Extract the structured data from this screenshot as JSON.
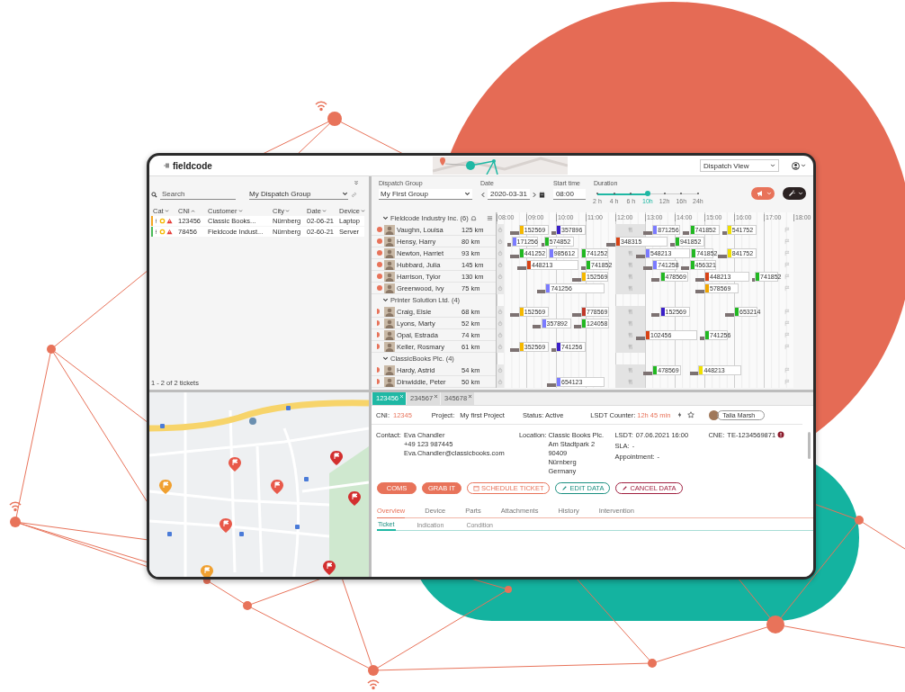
{
  "app": {
    "logo": "fieldcode",
    "view_select": "Dispatch View"
  },
  "tickets_panel": {
    "search": {
      "placeholder": "Search"
    },
    "group_select": "My Dispatch Group",
    "columns": [
      {
        "label": "Cat",
        "sorted": false
      },
      {
        "label": "CNI",
        "sorted": true
      },
      {
        "label": "Customer",
        "sorted": false
      },
      {
        "label": "City",
        "sorted": false
      },
      {
        "label": "Date",
        "sorted": false
      },
      {
        "label": "Device",
        "sorted": false
      }
    ],
    "rows": [
      {
        "color": "#f5a623",
        "cells": [
          "",
          "123456",
          "Classic Books...",
          "Nürnberg",
          "02-06-21",
          "Laptop"
        ]
      },
      {
        "color": "#4cbb5a",
        "cells": [
          "",
          "78456",
          "Fieldcode Indust...",
          "Nürnberg",
          "02-60-21",
          "Server"
        ]
      }
    ],
    "footer": "1 - 2 of 2 tickets"
  },
  "dispatch": {
    "group_label": "Dispatch Group",
    "group_select": "My First Group",
    "date_label": "Date",
    "date": "2020-03-31",
    "start_label": "Start time",
    "start_time": "08:00",
    "duration_label": "Duration",
    "duration_slider": {
      "level": 0.5
    },
    "durations": [
      {
        "label": "2 h",
        "selected": false
      },
      {
        "label": "4 h",
        "selected": false
      },
      {
        "label": "6 h",
        "selected": false
      },
      {
        "label": "10h",
        "selected": true
      },
      {
        "label": "12h",
        "selected": false
      },
      {
        "label": "16h",
        "selected": false
      },
      {
        "label": "24h",
        "selected": false
      }
    ],
    "hours": [
      "08:00",
      "09:00",
      "10:00",
      "11:00",
      "12:00",
      "13:00",
      "14:00",
      "15:00",
      "16:00",
      "17:00",
      "18:00"
    ],
    "groups": [
      {
        "name": "Fieldcode Industry Inc. (6)",
        "expanded": true,
        "technicians": [
          {
            "name": "Vaughn, Louisa",
            "distance": "125 km",
            "kind": "dot",
            "tickets": [
              {
                "id": "152569",
                "color": "#f5b800"
              },
              {
                "id": "357896",
                "color": "#3a1fc8"
              },
              {
                "id": "871256",
                "color": "#7b7bff"
              },
              {
                "id": "741852",
                "color": "#22b822"
              },
              {
                "id": "541752",
                "color": "#f0e000"
              }
            ]
          },
          {
            "name": "Hensy, Harry",
            "distance": "80 km",
            "kind": "dot",
            "tickets": [
              {
                "id": "171256",
                "color": "#7b7bff"
              },
              {
                "id": "574852",
                "color": "#22b822"
              },
              {
                "id": "348315",
                "color": "#d84315"
              },
              {
                "id": "941852",
                "color": "#22b822"
              }
            ]
          },
          {
            "name": "Newton, Harriet",
            "distance": "93 km",
            "kind": "dot",
            "tickets": [
              {
                "id": "441252",
                "color": "#22b822"
              },
              {
                "id": "985612",
                "color": "#7b7bff"
              },
              {
                "id": "741252",
                "color": "#22b822"
              },
              {
                "id": "548213",
                "color": "#7b7bff"
              },
              {
                "id": "741852",
                "color": "#22b822"
              },
              {
                "id": "841752",
                "color": "#f0e000"
              }
            ]
          },
          {
            "name": "Hubbard, Julia",
            "distance": "145 km",
            "kind": "dot",
            "tickets": [
              {
                "id": "448213",
                "color": "#d84315"
              },
              {
                "id": "741852",
                "color": "#22b822"
              },
              {
                "id": "741258",
                "color": "#7b7bff"
              },
              {
                "id": "456321",
                "color": "#22b822"
              }
            ]
          },
          {
            "name": "Harrison, Tylor",
            "distance": "130 km",
            "kind": "dot",
            "tickets": [
              {
                "id": "152569",
                "color": "#f5b800"
              },
              {
                "id": "478569",
                "color": "#22b822"
              },
              {
                "id": "448213",
                "color": "#d84315"
              },
              {
                "id": "741852",
                "color": "#22b822"
              }
            ]
          },
          {
            "name": "Greenwood, Ivy",
            "distance": "75 km",
            "kind": "dot",
            "tickets": [
              {
                "id": "741256",
                "color": "#7b7bff"
              },
              {
                "id": "578569",
                "color": "#f0a500"
              }
            ]
          }
        ]
      },
      {
        "name": "Printer Solution Ltd. (4)",
        "expanded": true,
        "technicians": [
          {
            "name": "Craig, Elsie",
            "distance": "68 km",
            "kind": "arrow",
            "tickets": [
              {
                "id": "152569",
                "color": "#f5b800"
              },
              {
                "id": "778569",
                "color": "#c0392b"
              },
              {
                "id": "152569",
                "color": "#3a1fc8"
              },
              {
                "id": "653214",
                "color": "#22b822"
              }
            ]
          },
          {
            "name": "Lyons, Marty",
            "distance": "52 km",
            "kind": "arrow",
            "tickets": [
              {
                "id": "357892",
                "color": "#7b7bff"
              },
              {
                "id": "124058",
                "color": "#22b822"
              }
            ]
          },
          {
            "name": "Opal, Estrada",
            "distance": "74 km",
            "kind": "arrow",
            "tickets": [
              {
                "id": "102456",
                "color": "#d84315"
              },
              {
                "id": "741256",
                "color": "#22b822"
              }
            ]
          },
          {
            "name": "Keller, Rosmary",
            "distance": "61 km",
            "kind": "arrow",
            "tickets": [
              {
                "id": "352569",
                "color": "#f5b800"
              },
              {
                "id": "741256",
                "color": "#3a1fc8"
              }
            ]
          }
        ]
      },
      {
        "name": "ClassicBooks Plc. (4)",
        "expanded": true,
        "technicians": [
          {
            "name": "Hardy, Astrid",
            "distance": "54 km",
            "kind": "arrow",
            "tickets": [
              {
                "id": "478569",
                "color": "#22b822"
              },
              {
                "id": "448213",
                "color": "#f0e000"
              }
            ]
          },
          {
            "name": "Dinwiddie, Peter",
            "distance": "50 km",
            "kind": "arrow",
            "tickets": [
              {
                "id": "654123",
                "color": "#7b7bff"
              }
            ]
          }
        ]
      }
    ]
  },
  "ticket_tabs": [
    {
      "label": "123456",
      "selected": true
    },
    {
      "label": "234567",
      "selected": false
    },
    {
      "label": "345678",
      "selected": false
    }
  ],
  "ticket": {
    "cni_label": "CNI:",
    "cni": "12345",
    "project_label": "Project:",
    "project": "My first Project",
    "status": "Status: Active",
    "counter_label": "LSDT Counter:",
    "counter": "12h 45 min",
    "assignee": "Talia Marsh",
    "contact_label": "Contact:",
    "contact": [
      "Eva Chandler",
      "+49 123 987445",
      "Eva.Chandler@classicbooks.com"
    ],
    "location_label": "Location:",
    "location": [
      "Classic Books Plc.",
      "Am Stadtpark 2",
      "90409",
      "Nürnberg",
      "Germany"
    ],
    "fields": [
      {
        "label": "LSDT:",
        "value": "07.06.2021 16:00"
      },
      {
        "label": "SLA:",
        "value": "-"
      },
      {
        "label": "Appointment:",
        "value": "-"
      }
    ],
    "cne_label": "CNE:",
    "cne": "TE-1234569871"
  },
  "actions": [
    {
      "label": "COMS",
      "kind": "filled"
    },
    {
      "label": "GRAB IT",
      "kind": "filled"
    },
    {
      "label": "SCHEDULE TICKET",
      "kind": "schedule"
    },
    {
      "label": "EDIT DATA",
      "kind": "edit"
    },
    {
      "label": "CANCEL DATA",
      "kind": "cancel"
    }
  ],
  "detail_tabs": [
    {
      "label": "Overview",
      "selected": true
    },
    {
      "label": "Device",
      "selected": false
    },
    {
      "label": "Parts",
      "selected": false
    },
    {
      "label": "Attachments",
      "selected": false
    },
    {
      "label": "History",
      "selected": false
    },
    {
      "label": "Intervention",
      "selected": false
    }
  ],
  "sub_tabs": [
    {
      "label": "Ticket",
      "selected": true
    },
    {
      "label": "Indication",
      "selected": false
    },
    {
      "label": "Condition",
      "selected": false
    }
  ]
}
